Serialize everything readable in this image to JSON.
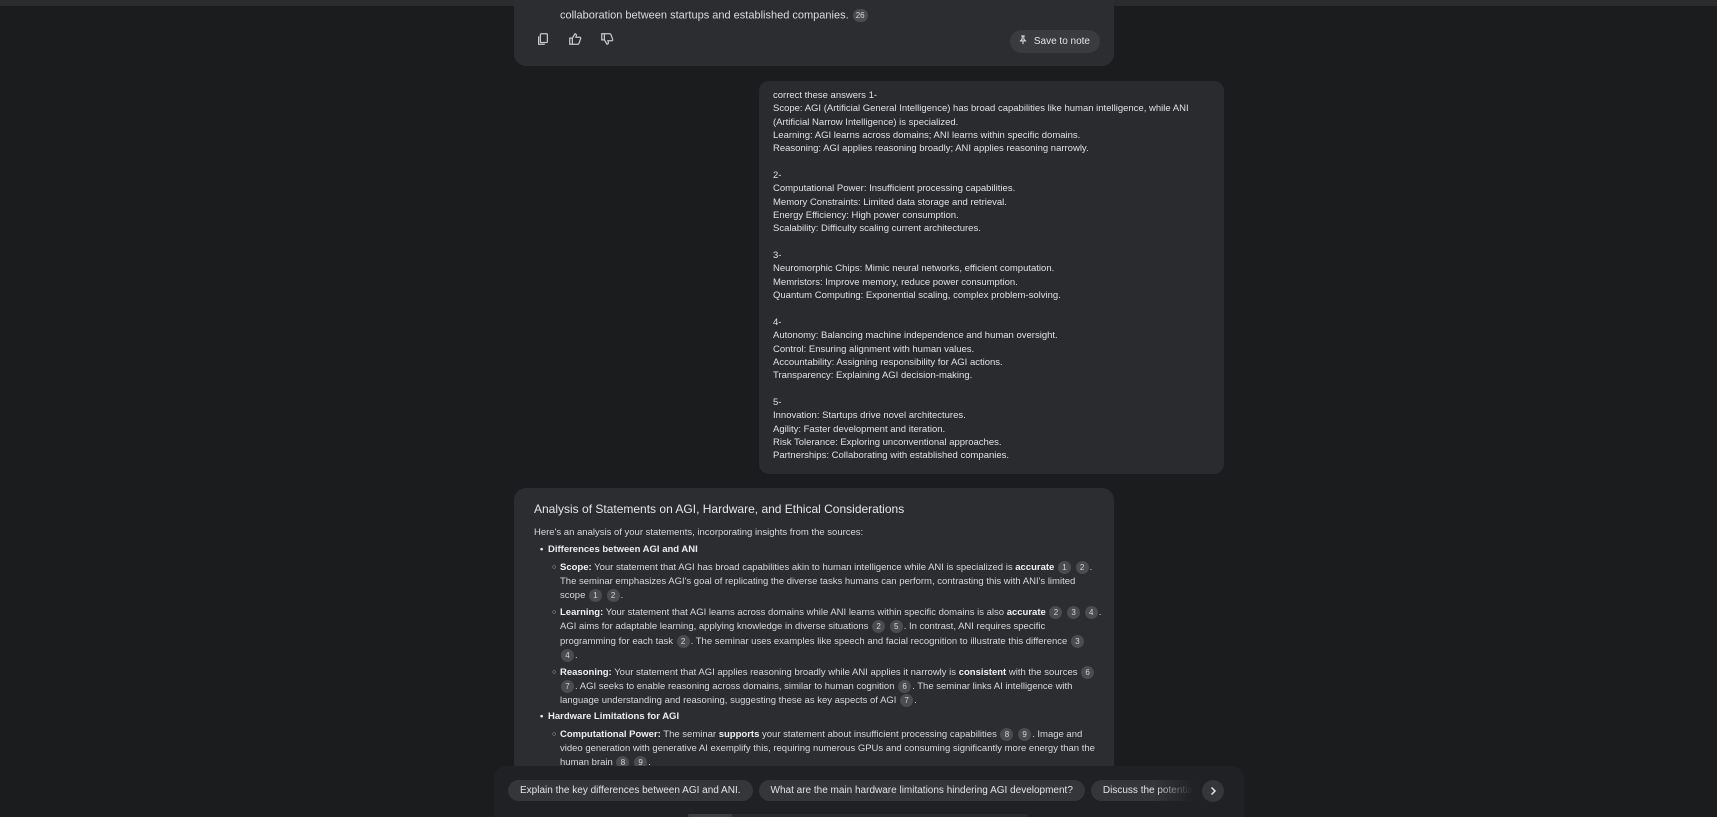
{
  "prev_response": {
    "last_line": "collaboration between startups and established companies.",
    "cite": "26",
    "save_label": "Save to note",
    "icons": [
      "copy-icon",
      "thumbs-up-icon",
      "thumbs-down-icon",
      "pin-icon"
    ]
  },
  "user_message": {
    "lines": [
      "correct these answers 1-",
      "Scope: AGI (Artificial General Intelligence) has broad capabilities like human intelligence, while ANI",
      "(Artificial Narrow Intelligence) is specialized.",
      "Learning: AGI learns across domains; ANI learns within specific domains.",
      "Reasoning: AGI applies reasoning broadly; ANI applies reasoning narrowly.",
      "",
      "2-",
      "Computational Power: Insufficient processing capabilities.",
      "Memory Constraints: Limited data storage and retrieval.",
      "Energy Efficiency: High power consumption.",
      "Scalability: Difficulty scaling current architectures.",
      "",
      "3-",
      "Neuromorphic Chips: Mimic neural networks, efficient computation.",
      "Memristors: Improve memory, reduce power consumption.",
      "Quantum Computing: Exponential scaling, complex problem-solving.",
      "",
      "4-",
      "Autonomy: Balancing machine independence and human oversight.",
      "Control: Ensuring alignment with human values.",
      "Accountability: Assigning responsibility for AGI actions.",
      "Transparency: Explaining AGI decision-making.",
      "",
      "5-",
      "Innovation: Startups drive novel architectures.",
      "Agility: Faster development and iteration.",
      "Risk Tolerance: Exploring unconventional approaches.",
      "Partnerships: Collaborating with established companies."
    ]
  },
  "answer": {
    "title": "Analysis of Statements on AGI, Hardware, and Ethical Considerations",
    "intro": "Here's an analysis of your statements, incorporating insights from the sources:",
    "section1": "Differences between AGI and ANI",
    "scope": {
      "label": "Scope:",
      "t1": " Your statement that AGI has broad capabilities akin to human intelligence while ANI is specialized is ",
      "b1": "accurate",
      "c": [
        "1",
        "2"
      ],
      "t2": ". The seminar emphasizes AGI's goal of replicating the diverse tasks humans can perform, contrasting this with ANI's limited scope",
      "c2": [
        "1",
        "2"
      ]
    },
    "learning": {
      "label": "Learning:",
      "t1": " Your statement that AGI learns across domains while ANI learns within specific domains is also ",
      "b1": "accurate",
      "c": [
        "2",
        "3",
        "4"
      ],
      "t2": ". AGI aims for adaptable learning, applying knowledge in diverse situations",
      "c2": [
        "2",
        "5"
      ],
      "t3": ". In contrast, ANI requires specific programming for each task",
      "c3": [
        "2"
      ],
      "t4": ". The seminar uses examples like speech and facial recognition to illustrate this difference",
      "c4": [
        "3",
        "4"
      ]
    },
    "reasoning": {
      "label": "Reasoning:",
      "t1": " Your statement that AGI applies reasoning broadly while ANI applies it narrowly is ",
      "b1": "consistent",
      "t1b": " with the sources",
      "c": [
        "6",
        "7"
      ],
      "t2": ". AGI seeks to enable reasoning across domains, similar to human cognition",
      "c2": [
        "6"
      ],
      "t3": ". The seminar links AI intelligence with language understanding and reasoning, suggesting these as key aspects of AGI",
      "c3": [
        "7"
      ]
    },
    "section2": "Hardware Limitations for AGI",
    "compute": {
      "label": "Computational Power:",
      "t1": " The seminar ",
      "b1": "supports",
      "t1b": " your statement about insufficient processing capabilities",
      "c": [
        "8",
        "9"
      ],
      "t2": ". Image and video generation with generative AI exemplify this, requiring numerous GPUs and consuming significantly more energy than the human brain",
      "c2": [
        "8",
        "9"
      ]
    }
  },
  "suggestions": [
    "Explain the key differences between AGI and ANI.",
    "What are the main hardware limitations hindering AGI development?",
    "Discuss the potential role of startups"
  ]
}
